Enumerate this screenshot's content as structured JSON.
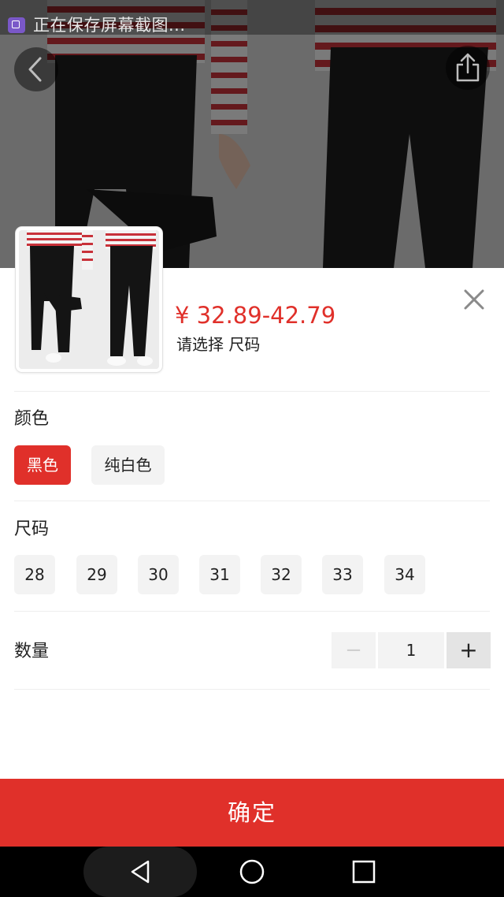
{
  "status_bar": {
    "notification_text": "正在保存屏幕截图..."
  },
  "product": {
    "price_text": "¥ 32.89-42.79",
    "select_hint": "请选择 尺码"
  },
  "color_section": {
    "label": "颜色",
    "options": [
      "黑色",
      "纯白色"
    ],
    "selected": "黑色"
  },
  "size_section": {
    "label": "尺码",
    "options": [
      "28",
      "29",
      "30",
      "31",
      "32",
      "33",
      "34"
    ]
  },
  "quantity": {
    "label": "数量",
    "value": "1",
    "minus_symbol": "−",
    "plus_symbol": "+"
  },
  "confirm_label": "确定",
  "colors": {
    "accent": "#e0302a",
    "chip_bg": "#f3f3f3"
  },
  "icons": {
    "back": "chevron-left-icon",
    "share": "share-icon",
    "close": "close-icon",
    "nav_back": "triangle-back-icon",
    "nav_home": "circle-home-icon",
    "nav_recent": "square-recent-icon"
  }
}
